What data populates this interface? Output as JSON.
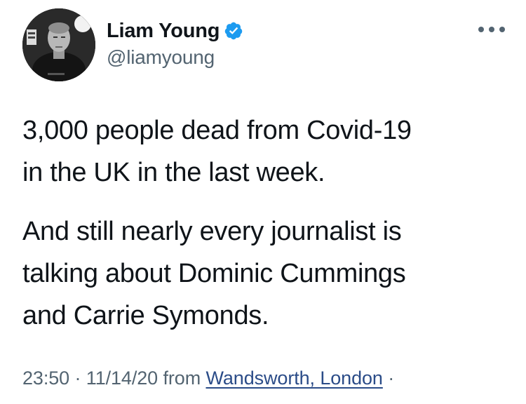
{
  "author": {
    "display_name": "Liam Young",
    "handle": "@liamyoung",
    "verified": true,
    "verified_icon": "verified-badge-icon",
    "avatar_icon": "profile-photo"
  },
  "menu": {
    "icon": "more-options-icon"
  },
  "tweet": {
    "paragraph1": {
      "line1": "3,000 people dead from Covid-19",
      "line2": "in the UK in the last week."
    },
    "paragraph2": {
      "line1": "And still nearly every journalist is",
      "line2": "talking about Dominic Cummings",
      "line3": "and Carrie Symonds."
    }
  },
  "meta": {
    "time": "23:50",
    "separator": " · ",
    "date": "11/14/20",
    "from_label": " from ",
    "location": "Wandsworth, London",
    "trailing": " ·"
  },
  "colors": {
    "text": "#0f1419",
    "secondary": "#536471",
    "verified": "#1d9bf0",
    "link": "#2b4c88"
  }
}
